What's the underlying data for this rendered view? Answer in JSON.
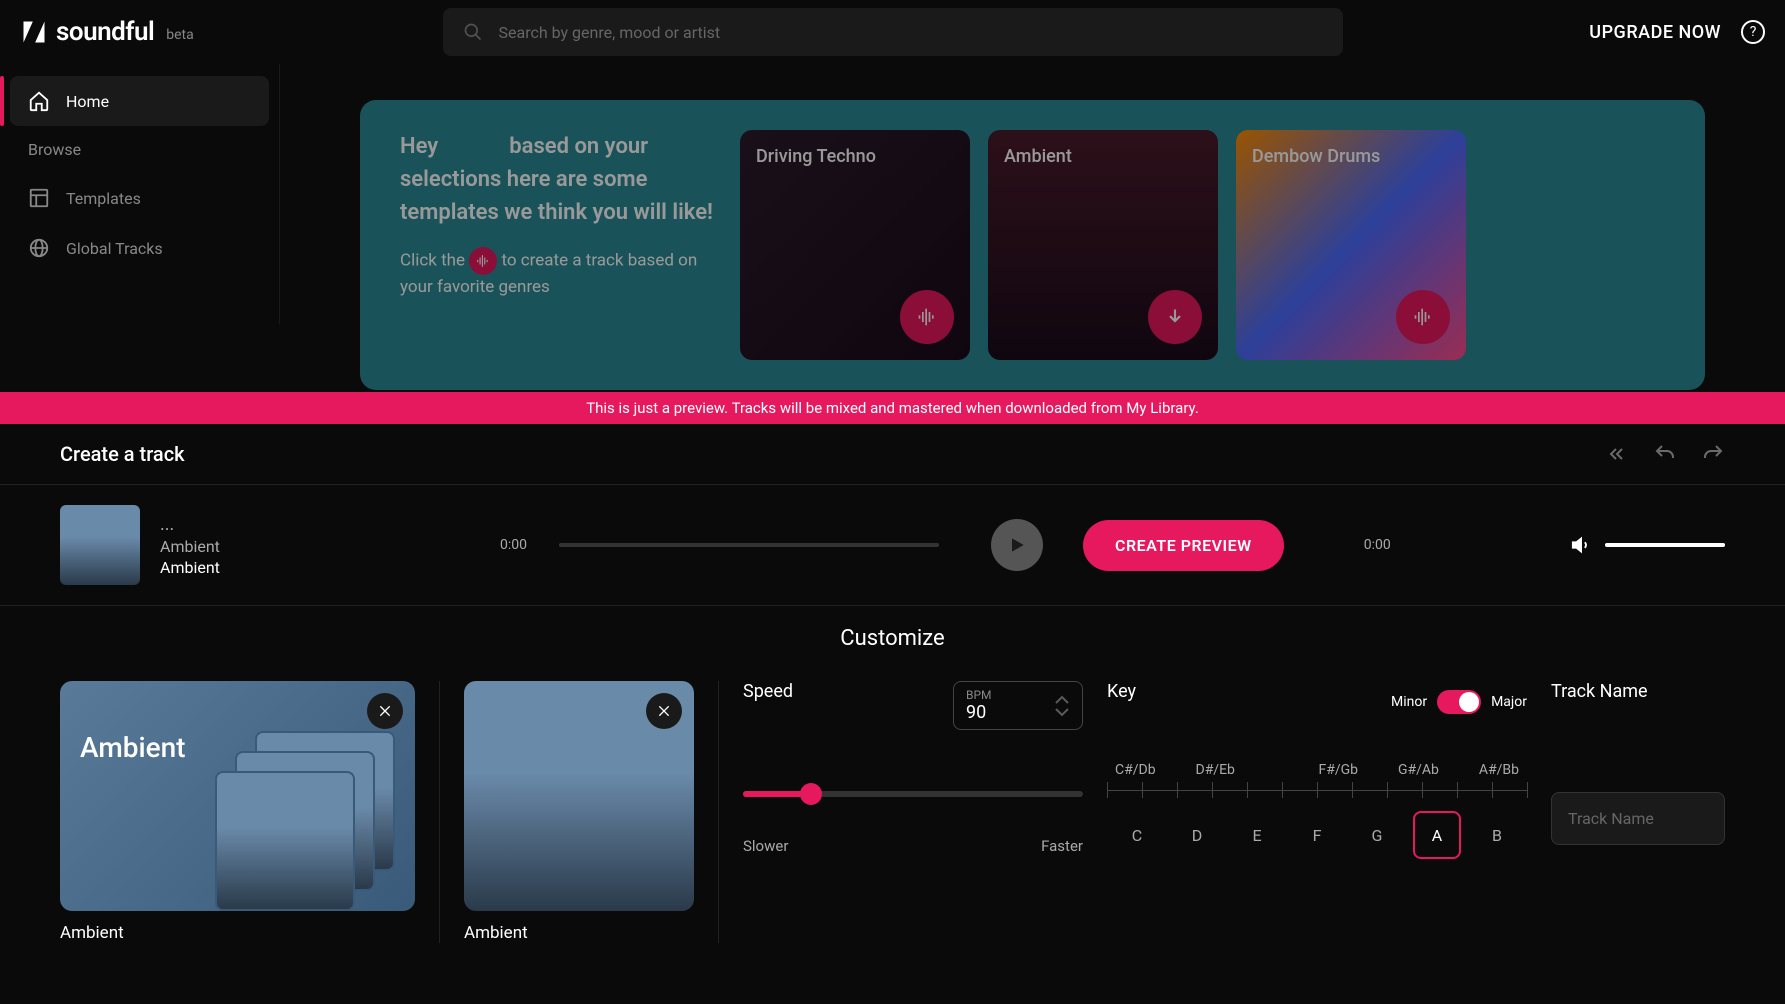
{
  "header": {
    "logo_text": "soundful",
    "beta": "beta",
    "search_placeholder": "Search by genre, mood or artist",
    "upgrade": "UPGRADE NOW"
  },
  "sidebar": {
    "home": "Home",
    "browse": "Browse",
    "templates": "Templates",
    "global_tracks": "Global Tracks"
  },
  "hero": {
    "heading": "Hey             based on your selections here are some templates we think you will like!",
    "sub_pre": "Click the ",
    "sub_post": " to create a track based on your favorite genres",
    "cards": [
      "Driving Techno",
      "Ambient",
      "Dembow Drums"
    ]
  },
  "banner": "This is just a preview. Tracks will be mixed and mastered when downloaded from My Library.",
  "create": {
    "title": "Create a track",
    "track_dots": "...",
    "track_line1": "Ambient",
    "track_line2": "Ambient",
    "time_start": "0:00",
    "time_end": "0:00",
    "preview_btn": "CREATE PREVIEW"
  },
  "customize": {
    "title": "Customize",
    "genre_card_label": "Ambient",
    "genre_caption1": "Ambient",
    "genre_caption2": "Ambient",
    "speed_label": "Speed",
    "bpm_label": "BPM",
    "bpm_value": "90",
    "slower": "Slower",
    "faster": "Faster",
    "key_label": "Key",
    "minor": "Minor",
    "major": "Major",
    "sharps": [
      "C#/Db",
      "D#/Eb",
      "",
      "F#/Gb",
      "G#/Ab",
      "A#/Bb"
    ],
    "notes": [
      "C",
      "D",
      "E",
      "F",
      "G",
      "A",
      "B"
    ],
    "selected_note": "A",
    "trackname_label": "Track Name",
    "trackname_placeholder": "Track Name"
  }
}
